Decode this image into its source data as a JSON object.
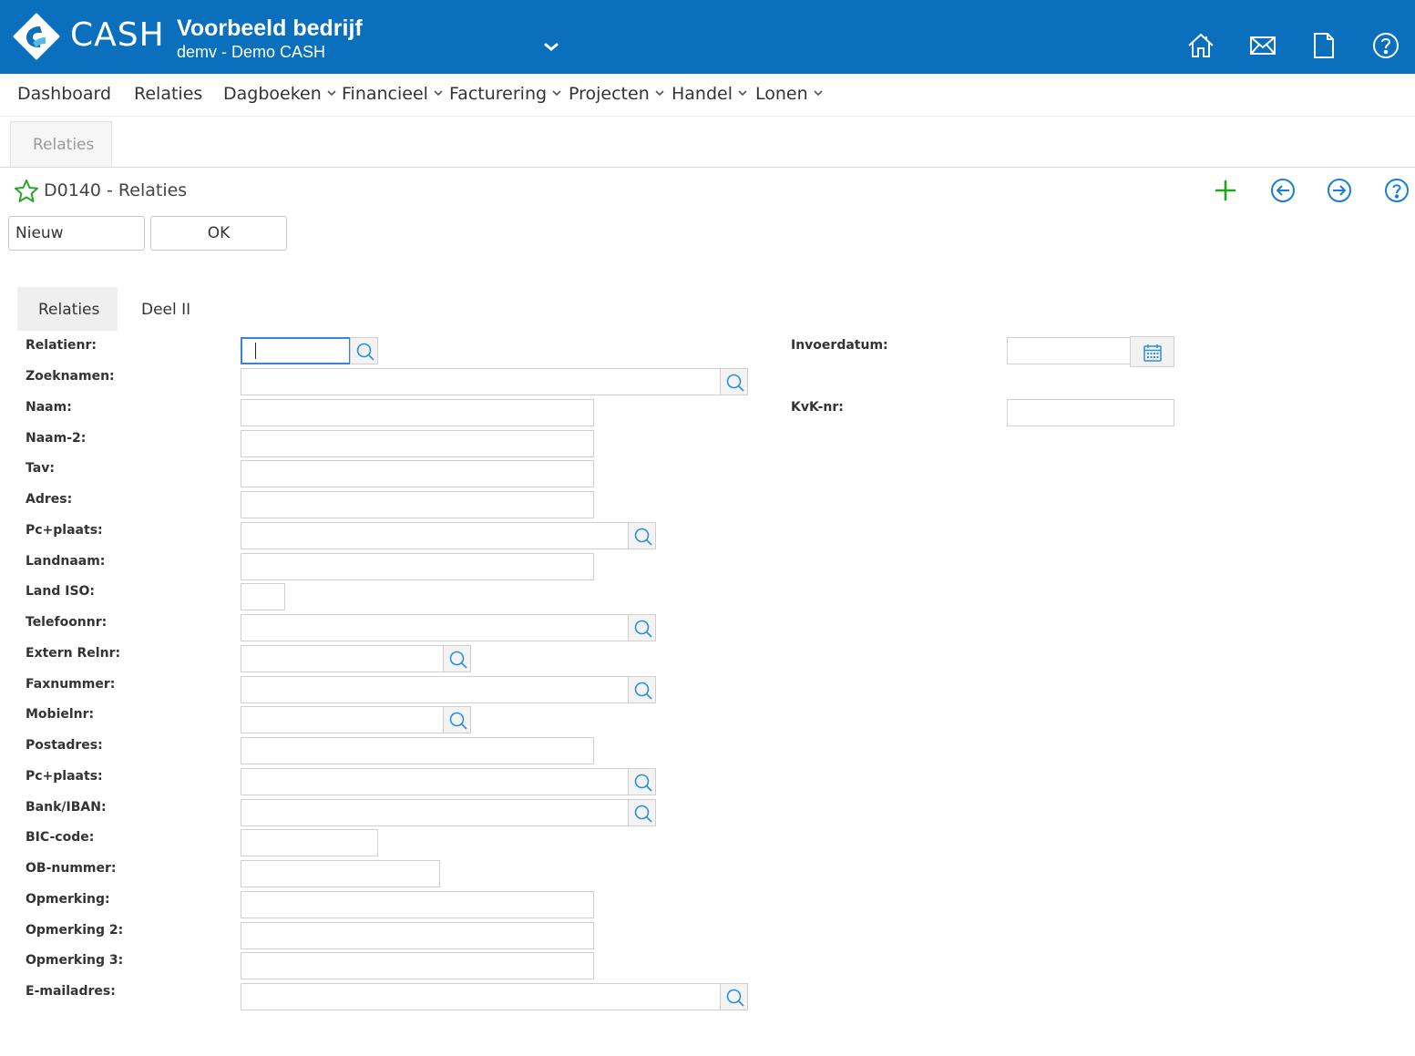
{
  "app": {
    "logo_text": "CASH",
    "company": "Voorbeeld bedrijf",
    "administration": "demv - Demo CASH",
    "header_icons": [
      "home-icon",
      "mail-icon",
      "document-icon",
      "help-icon"
    ]
  },
  "nav": {
    "items": [
      {
        "label": "Dashboard",
        "has_menu": false
      },
      {
        "label": "Relaties",
        "has_menu": false
      },
      {
        "label": "Dagboeken",
        "has_menu": true
      },
      {
        "label": "Financieel",
        "has_menu": true
      },
      {
        "label": "Facturering",
        "has_menu": true
      },
      {
        "label": "Projecten",
        "has_menu": true
      },
      {
        "label": "Handel",
        "has_menu": true
      },
      {
        "label": "Lonen",
        "has_menu": true
      }
    ]
  },
  "window_tab": {
    "label": "Relaties"
  },
  "page": {
    "title": "D0140 - Relaties",
    "actions": [
      "add-icon",
      "previous-icon",
      "next-icon",
      "help-icon"
    ],
    "buttons": {
      "new": "Nieuw",
      "ok": "OK"
    }
  },
  "form_tabs": [
    {
      "label": "Relaties",
      "active": true
    },
    {
      "label": "Deel II",
      "active": false
    }
  ],
  "form": {
    "fields": [
      {
        "label": "Relatienr:",
        "value": "",
        "lookup": true,
        "focused": true
      },
      {
        "label": "Zoeknamen:",
        "value": "",
        "lookup": true
      },
      {
        "label": "Naam:",
        "value": "",
        "lookup": false
      },
      {
        "label": "Naam-2:",
        "value": "",
        "lookup": false
      },
      {
        "label": "Tav:",
        "value": "",
        "lookup": false
      },
      {
        "label": "Adres:",
        "value": "",
        "lookup": false
      },
      {
        "label": "Pc+plaats:",
        "value": "",
        "lookup": true
      },
      {
        "label": "Landnaam:",
        "value": "",
        "lookup": false
      },
      {
        "label": "Land ISO:",
        "value": "",
        "lookup": false
      },
      {
        "label": "Telefoonnr:",
        "value": "",
        "lookup": true
      },
      {
        "label": "Extern Relnr:",
        "value": "",
        "lookup": true
      },
      {
        "label": "Faxnummer:",
        "value": "",
        "lookup": true
      },
      {
        "label": "Mobielnr:",
        "value": "",
        "lookup": true
      },
      {
        "label": "Postadres:",
        "value": "",
        "lookup": false
      },
      {
        "label": "Pc+plaats:",
        "value": "",
        "lookup": true
      },
      {
        "label": "Bank/IBAN:",
        "value": "",
        "lookup": true
      },
      {
        "label": "BIC-code:",
        "value": "",
        "lookup": false
      },
      {
        "label": "OB-nummer:",
        "value": "",
        "lookup": false
      },
      {
        "label": "Opmerking:",
        "value": "",
        "lookup": false
      },
      {
        "label": "Opmerking 2:",
        "value": "",
        "lookup": false
      },
      {
        "label": "Opmerking 3:",
        "value": "",
        "lookup": false
      },
      {
        "label": "E-mailadres:",
        "value": "",
        "lookup": true
      }
    ],
    "right_fields": [
      {
        "label": "Invoerdatum:",
        "value": "",
        "calendar": true
      },
      {
        "label": "KvK-nr:",
        "value": "",
        "calendar": false
      }
    ]
  },
  "colors": {
    "header": "#0a6fbd",
    "accent_blue": "#1a7fd4",
    "add_green": "#1fa71f",
    "star_green": "#2aa52a"
  }
}
